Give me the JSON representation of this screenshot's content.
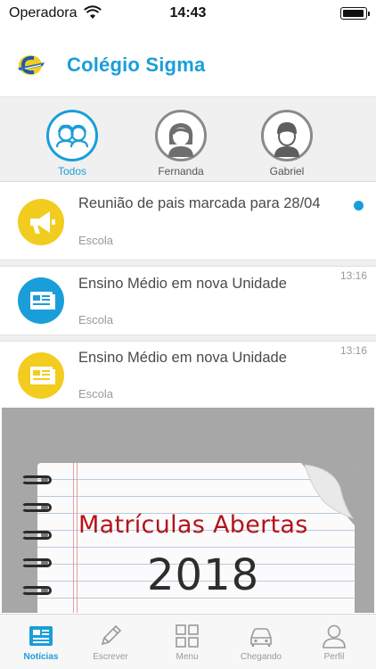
{
  "status_bar": {
    "carrier": "Operadora",
    "time": "14:43"
  },
  "header": {
    "title": "Colégio Sigma",
    "logo_icon": "school-logo-icon"
  },
  "filters": [
    {
      "label": "Todos",
      "icon": "group-avatar-icon",
      "active": true
    },
    {
      "label": "Fernanda",
      "icon": "female-avatar-icon",
      "active": false
    },
    {
      "label": "Gabriel",
      "icon": "male-avatar-icon",
      "active": false
    }
  ],
  "feed": [
    {
      "title": "Reunião de pais marcada para 28/04",
      "source": "Escola",
      "time": "",
      "unread": true,
      "icon": "megaphone-icon",
      "icon_color": "#f2cc1e"
    },
    {
      "title": "Ensino Médio em nova Unidade",
      "source": "Escola",
      "time": "13:16",
      "unread": false,
      "icon": "news-icon",
      "icon_color": "#1a9ed9"
    },
    {
      "title": "Ensino Médio em nova Unidade",
      "source": "Escola",
      "time": "13:16",
      "unread": false,
      "icon": "news-icon",
      "icon_color": "#f2cc1e"
    }
  ],
  "banner": {
    "heading": "Matrículas Abertas",
    "year": "2018"
  },
  "tabs": [
    {
      "label": "Notícias",
      "icon": "news-tab-icon",
      "active": true
    },
    {
      "label": "Escrever",
      "icon": "pencil-icon",
      "active": false
    },
    {
      "label": "Menu",
      "icon": "grid-icon",
      "active": false
    },
    {
      "label": "Chegando",
      "icon": "car-icon",
      "active": false
    },
    {
      "label": "Perfil",
      "icon": "profile-icon",
      "active": false
    }
  ],
  "colors": {
    "accent": "#1a9ed9",
    "yellow": "#f2cc1e",
    "banner_red": "#b5121b"
  }
}
